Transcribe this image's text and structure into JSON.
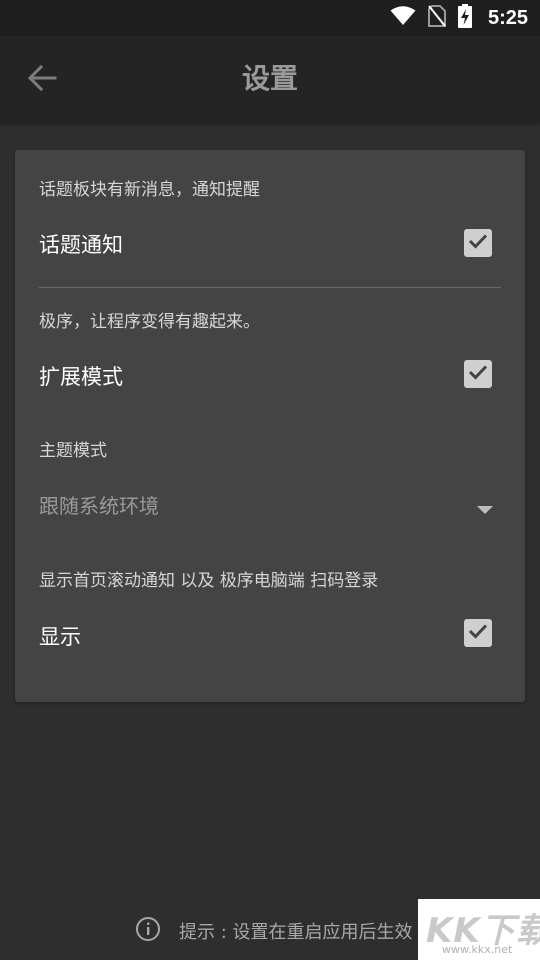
{
  "status_bar": {
    "time": "5:25",
    "icons": [
      "wifi-icon",
      "no-sim-icon",
      "battery-charging-icon"
    ]
  },
  "app_bar": {
    "back_icon": "arrow-left-icon",
    "title": "设置"
  },
  "settings": {
    "topic_notify": {
      "description": "话题板块有新消息，通知提醒",
      "label": "话题通知",
      "checked": true
    },
    "extend_mode": {
      "description": "极序，让程序变得有趣起来。",
      "label": "扩展模式",
      "checked": true
    },
    "theme_mode": {
      "label": "主题模式",
      "selected": "跟随系统环境"
    },
    "show_scroll": {
      "description": "显示首页滚动通知 以及 极序电脑端 扫码登录",
      "label": "显示",
      "checked": true
    }
  },
  "footer": {
    "info_icon": "info-circle-icon",
    "hint": "提示 : 设置在重启应用后生效"
  },
  "watermark": {
    "text": "KK下载",
    "url": "www.kkx.net"
  },
  "colors": {
    "background": "#2e2e2e",
    "app_bar": "#242424",
    "card": "#444444",
    "checkbox": "#cfcfcf"
  }
}
